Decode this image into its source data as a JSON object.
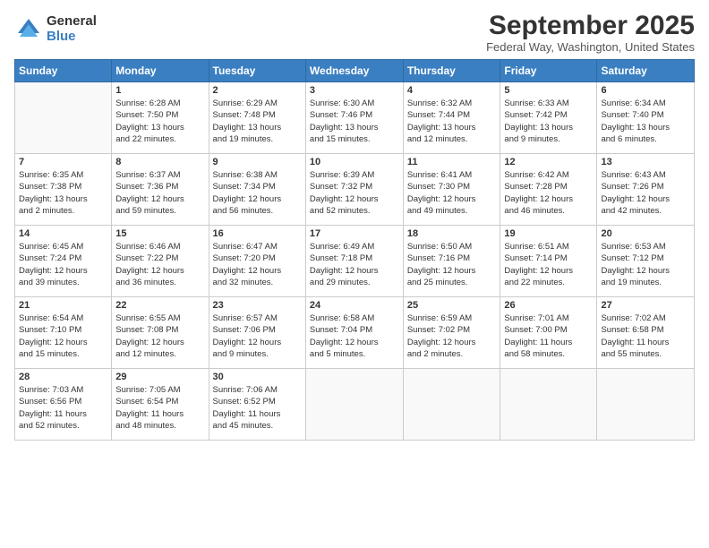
{
  "logo": {
    "general": "General",
    "blue": "Blue"
  },
  "title": "September 2025",
  "location": "Federal Way, Washington, United States",
  "headers": [
    "Sunday",
    "Monday",
    "Tuesday",
    "Wednesday",
    "Thursday",
    "Friday",
    "Saturday"
  ],
  "weeks": [
    [
      {
        "day": "",
        "lines": []
      },
      {
        "day": "1",
        "lines": [
          "Sunrise: 6:28 AM",
          "Sunset: 7:50 PM",
          "Daylight: 13 hours",
          "and 22 minutes."
        ]
      },
      {
        "day": "2",
        "lines": [
          "Sunrise: 6:29 AM",
          "Sunset: 7:48 PM",
          "Daylight: 13 hours",
          "and 19 minutes."
        ]
      },
      {
        "day": "3",
        "lines": [
          "Sunrise: 6:30 AM",
          "Sunset: 7:46 PM",
          "Daylight: 13 hours",
          "and 15 minutes."
        ]
      },
      {
        "day": "4",
        "lines": [
          "Sunrise: 6:32 AM",
          "Sunset: 7:44 PM",
          "Daylight: 13 hours",
          "and 12 minutes."
        ]
      },
      {
        "day": "5",
        "lines": [
          "Sunrise: 6:33 AM",
          "Sunset: 7:42 PM",
          "Daylight: 13 hours",
          "and 9 minutes."
        ]
      },
      {
        "day": "6",
        "lines": [
          "Sunrise: 6:34 AM",
          "Sunset: 7:40 PM",
          "Daylight: 13 hours",
          "and 6 minutes."
        ]
      }
    ],
    [
      {
        "day": "7",
        "lines": [
          "Sunrise: 6:35 AM",
          "Sunset: 7:38 PM",
          "Daylight: 13 hours",
          "and 2 minutes."
        ]
      },
      {
        "day": "8",
        "lines": [
          "Sunrise: 6:37 AM",
          "Sunset: 7:36 PM",
          "Daylight: 12 hours",
          "and 59 minutes."
        ]
      },
      {
        "day": "9",
        "lines": [
          "Sunrise: 6:38 AM",
          "Sunset: 7:34 PM",
          "Daylight: 12 hours",
          "and 56 minutes."
        ]
      },
      {
        "day": "10",
        "lines": [
          "Sunrise: 6:39 AM",
          "Sunset: 7:32 PM",
          "Daylight: 12 hours",
          "and 52 minutes."
        ]
      },
      {
        "day": "11",
        "lines": [
          "Sunrise: 6:41 AM",
          "Sunset: 7:30 PM",
          "Daylight: 12 hours",
          "and 49 minutes."
        ]
      },
      {
        "day": "12",
        "lines": [
          "Sunrise: 6:42 AM",
          "Sunset: 7:28 PM",
          "Daylight: 12 hours",
          "and 46 minutes."
        ]
      },
      {
        "day": "13",
        "lines": [
          "Sunrise: 6:43 AM",
          "Sunset: 7:26 PM",
          "Daylight: 12 hours",
          "and 42 minutes."
        ]
      }
    ],
    [
      {
        "day": "14",
        "lines": [
          "Sunrise: 6:45 AM",
          "Sunset: 7:24 PM",
          "Daylight: 12 hours",
          "and 39 minutes."
        ]
      },
      {
        "day": "15",
        "lines": [
          "Sunrise: 6:46 AM",
          "Sunset: 7:22 PM",
          "Daylight: 12 hours",
          "and 36 minutes."
        ]
      },
      {
        "day": "16",
        "lines": [
          "Sunrise: 6:47 AM",
          "Sunset: 7:20 PM",
          "Daylight: 12 hours",
          "and 32 minutes."
        ]
      },
      {
        "day": "17",
        "lines": [
          "Sunrise: 6:49 AM",
          "Sunset: 7:18 PM",
          "Daylight: 12 hours",
          "and 29 minutes."
        ]
      },
      {
        "day": "18",
        "lines": [
          "Sunrise: 6:50 AM",
          "Sunset: 7:16 PM",
          "Daylight: 12 hours",
          "and 25 minutes."
        ]
      },
      {
        "day": "19",
        "lines": [
          "Sunrise: 6:51 AM",
          "Sunset: 7:14 PM",
          "Daylight: 12 hours",
          "and 22 minutes."
        ]
      },
      {
        "day": "20",
        "lines": [
          "Sunrise: 6:53 AM",
          "Sunset: 7:12 PM",
          "Daylight: 12 hours",
          "and 19 minutes."
        ]
      }
    ],
    [
      {
        "day": "21",
        "lines": [
          "Sunrise: 6:54 AM",
          "Sunset: 7:10 PM",
          "Daylight: 12 hours",
          "and 15 minutes."
        ]
      },
      {
        "day": "22",
        "lines": [
          "Sunrise: 6:55 AM",
          "Sunset: 7:08 PM",
          "Daylight: 12 hours",
          "and 12 minutes."
        ]
      },
      {
        "day": "23",
        "lines": [
          "Sunrise: 6:57 AM",
          "Sunset: 7:06 PM",
          "Daylight: 12 hours",
          "and 9 minutes."
        ]
      },
      {
        "day": "24",
        "lines": [
          "Sunrise: 6:58 AM",
          "Sunset: 7:04 PM",
          "Daylight: 12 hours",
          "and 5 minutes."
        ]
      },
      {
        "day": "25",
        "lines": [
          "Sunrise: 6:59 AM",
          "Sunset: 7:02 PM",
          "Daylight: 12 hours",
          "and 2 minutes."
        ]
      },
      {
        "day": "26",
        "lines": [
          "Sunrise: 7:01 AM",
          "Sunset: 7:00 PM",
          "Daylight: 11 hours",
          "and 58 minutes."
        ]
      },
      {
        "day": "27",
        "lines": [
          "Sunrise: 7:02 AM",
          "Sunset: 6:58 PM",
          "Daylight: 11 hours",
          "and 55 minutes."
        ]
      }
    ],
    [
      {
        "day": "28",
        "lines": [
          "Sunrise: 7:03 AM",
          "Sunset: 6:56 PM",
          "Daylight: 11 hours",
          "and 52 minutes."
        ]
      },
      {
        "day": "29",
        "lines": [
          "Sunrise: 7:05 AM",
          "Sunset: 6:54 PM",
          "Daylight: 11 hours",
          "and 48 minutes."
        ]
      },
      {
        "day": "30",
        "lines": [
          "Sunrise: 7:06 AM",
          "Sunset: 6:52 PM",
          "Daylight: 11 hours",
          "and 45 minutes."
        ]
      },
      {
        "day": "",
        "lines": []
      },
      {
        "day": "",
        "lines": []
      },
      {
        "day": "",
        "lines": []
      },
      {
        "day": "",
        "lines": []
      }
    ]
  ]
}
